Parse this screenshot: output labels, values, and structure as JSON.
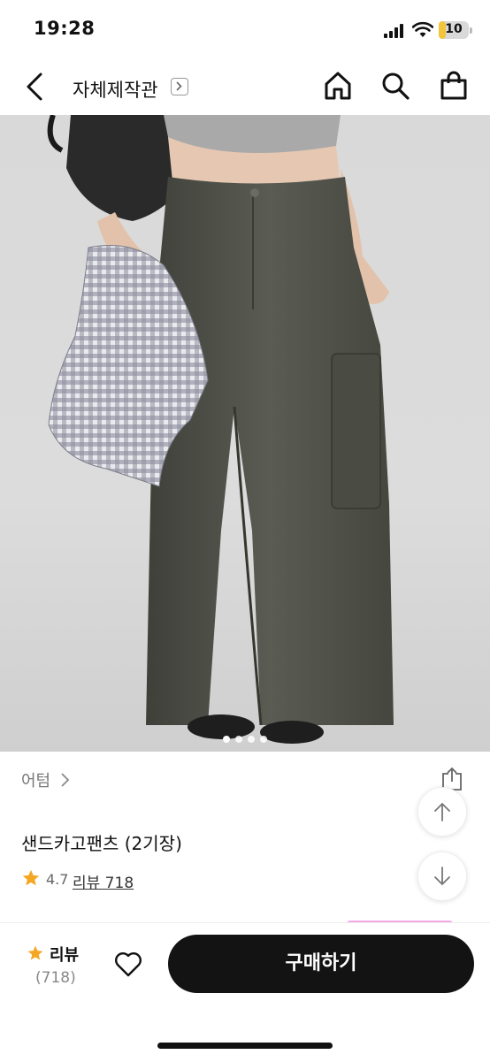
{
  "status_bar": {
    "time": "19:28",
    "battery": "10",
    "battery_level": 0.1
  },
  "nav": {
    "title": "자체제작관"
  },
  "hero": {
    "slide_count": 4,
    "active_slide": 1
  },
  "product": {
    "brand": "어텀",
    "name": "샌드카고팬츠 (2기장)",
    "rating": "4.7",
    "review_link": "리뷰 718"
  },
  "bottom_bar": {
    "review_label": "리뷰",
    "review_count": "(718)",
    "buy_label": "구매하기"
  },
  "icons": [
    "back-icon",
    "chevron-right-icon",
    "home-icon",
    "search-icon",
    "shopping-bag-icon",
    "share-icon",
    "arrow-up-icon",
    "arrow-down-icon",
    "star-icon",
    "heart-icon"
  ],
  "colors": {
    "star": "#f5a623",
    "buy_button": "#131313",
    "accent_pink": "#f3a9e6"
  }
}
